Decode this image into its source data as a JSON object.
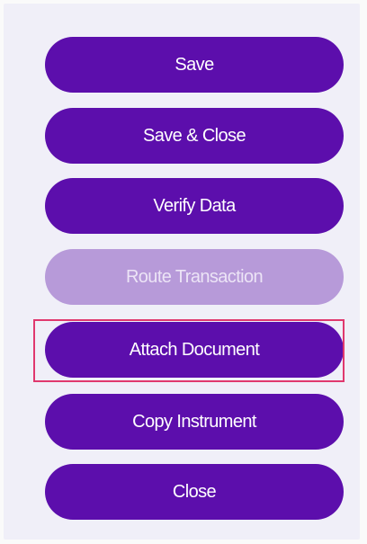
{
  "actions": {
    "save": {
      "label": "Save",
      "enabled": true
    },
    "save_close": {
      "label": "Save & Close",
      "enabled": true
    },
    "verify_data": {
      "label": "Verify Data",
      "enabled": true
    },
    "route_transaction": {
      "label": "Route Transaction",
      "enabled": false
    },
    "attach_document": {
      "label": "Attach Document",
      "enabled": true,
      "highlighted": true
    },
    "copy_instrument": {
      "label": "Copy Instrument",
      "enabled": true
    },
    "close": {
      "label": "Close",
      "enabled": true
    }
  },
  "colors": {
    "button": "#5c0eac",
    "button_disabled": "#b79ad9",
    "highlight_border": "#e0386e",
    "panel_bg": "#f0eff8"
  }
}
